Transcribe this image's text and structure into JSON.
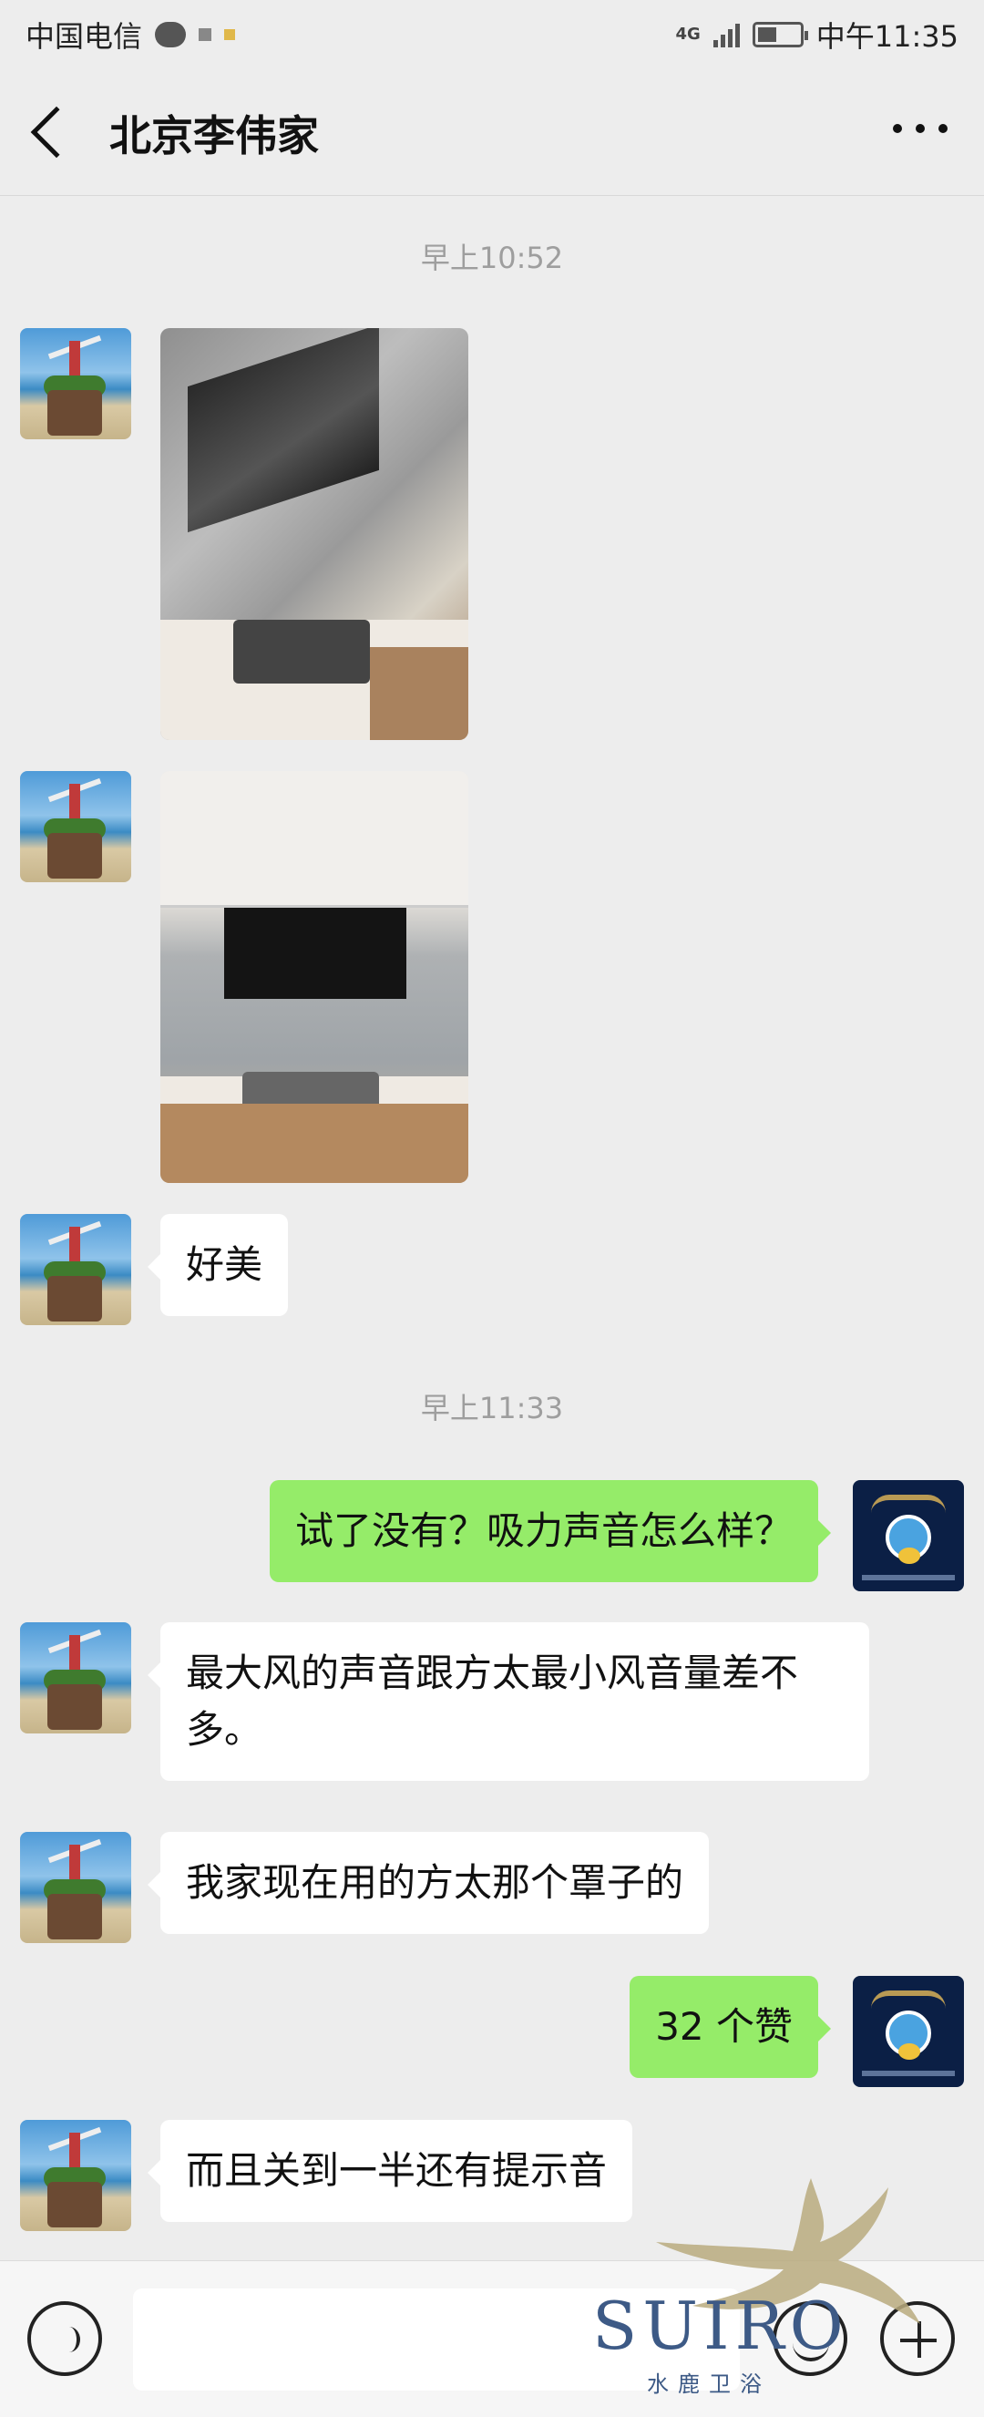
{
  "status_bar": {
    "carrier": "中国电信",
    "network": "4G",
    "time": "中午11:35"
  },
  "header": {
    "title": "北京李伟家"
  },
  "messages": {
    "ts1": "早上10:52",
    "ts2": "早上11:33",
    "m_good": "好美",
    "m_tried": "试了没有？吸力声音怎么样？",
    "m_max": "最大风的声音跟方太最小风音量差不多。",
    "m_home": "我家现在用的方太那个罩子的",
    "m_like": "32 个赞",
    "m_half": "而且关到一半还有提示音"
  },
  "watermark": {
    "brand": "SUIRO",
    "subtitle": "水鹿卫浴"
  },
  "icons": {
    "back": "back-arrow-icon",
    "more": "more-dots-icon",
    "voice": "voice-icon",
    "emoji": "emoji-icon",
    "plus": "plus-icon"
  },
  "colors": {
    "bubble_self": "#95ec69",
    "bubble_other": "#ffffff",
    "background": "#ededed"
  }
}
